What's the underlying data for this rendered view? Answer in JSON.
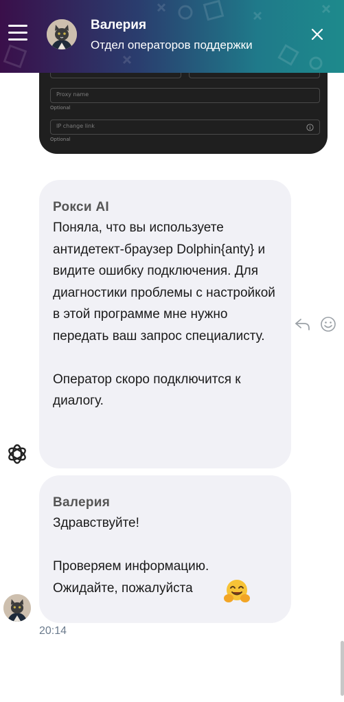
{
  "header": {
    "name": "Валерия",
    "subtitle": "Отдел операторов поддержки"
  },
  "form_card": {
    "proxy_name_placeholder": "Proxy name",
    "proxy_name_help": "Optional",
    "ip_change_placeholder": "IP change link",
    "ip_change_help": "Optional"
  },
  "messages": [
    {
      "author": "Рокси AI",
      "text": "Поняла, что вы используете антидетект-браузер Dolphin{anty} и видите ошибку подключения. Для диагностики проблемы с настройкой в этой программе мне нужно передать ваш запрос специалисту.\n\nОператор скоро подключится к диалогу."
    },
    {
      "author": "Валерия",
      "text": "Здравствуйте!\n\nПроверяем информацию.\nОжидайте, пожалуйста"
    }
  ],
  "timestamp": "20:14",
  "icons": {
    "menu": "hamburger-icon",
    "close": "close-icon",
    "reply": "reply-icon",
    "emoji": "emoji-icon",
    "bot": "openai-logo-icon",
    "hug": "hugging-face-emoji"
  }
}
